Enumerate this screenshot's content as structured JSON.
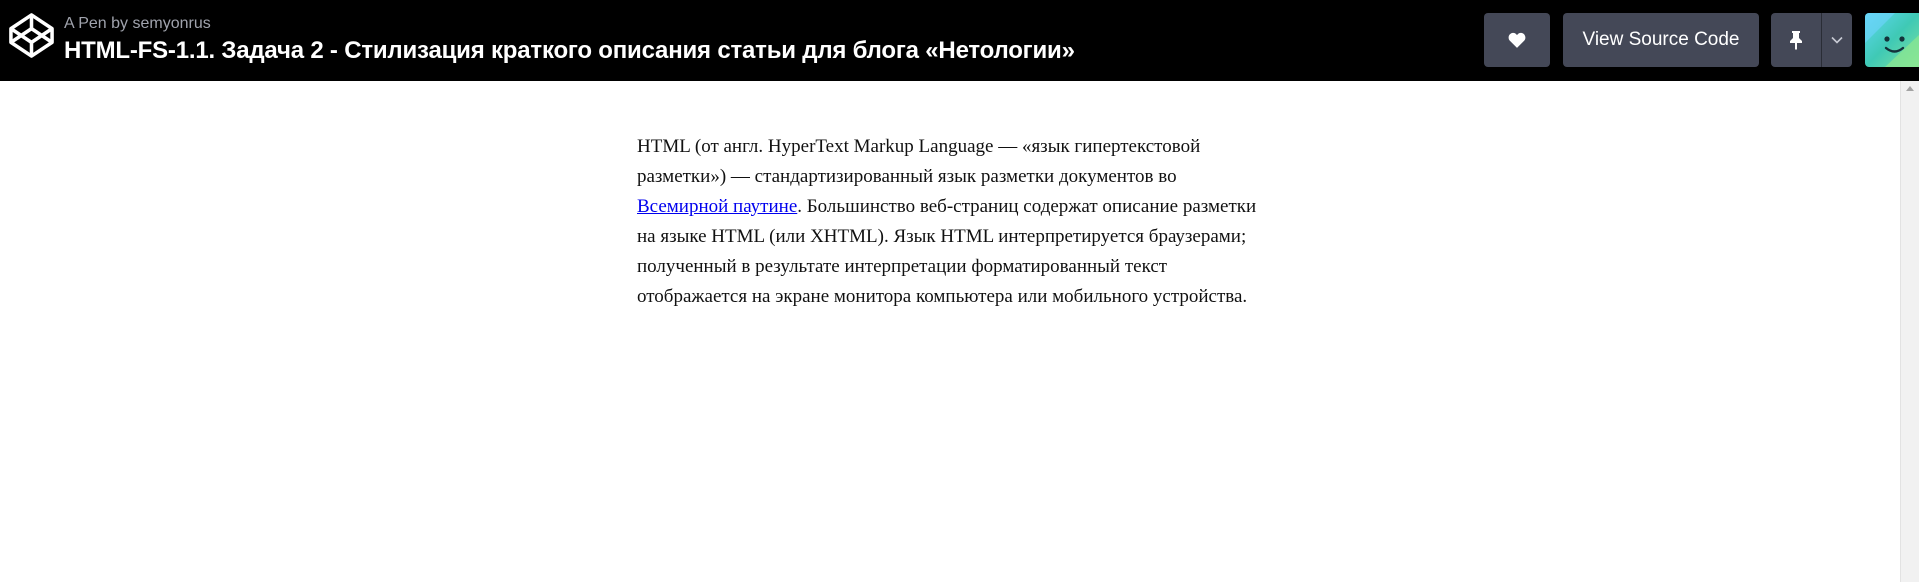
{
  "header": {
    "pen_by": "A Pen by semyonrus",
    "title": "HTML-FS-1.1. Задача 2 - Стилизация краткого описания статьи для блога «Нетологии»",
    "buttons": {
      "heart_icon": "heart-icon",
      "view_source_label": "View Source Code",
      "pin_icon": "pin-icon",
      "more_icon": "chevron-down-icon"
    },
    "logo_icon": "codepen-logo-icon",
    "avatar_icon": "avatar"
  },
  "article": {
    "text_before_link": "HTML (от англ. HyperText Markup Language — «язык гипертекстовой разметки») — стандартизированный язык разметки документов во ",
    "link_text": "Всемирной паутине",
    "text_after_link": ". Большинство веб-страниц содержат описание разметки на языке HTML (или XHTML). Язык HTML интерпретируется браузерами; полученный в результате интерпретации форматированный текст отображается на экране монитора компьютера или мобильного устройства."
  },
  "colors": {
    "topbar_bg": "#000000",
    "button_bg": "#444857",
    "link": "#0000ee"
  }
}
